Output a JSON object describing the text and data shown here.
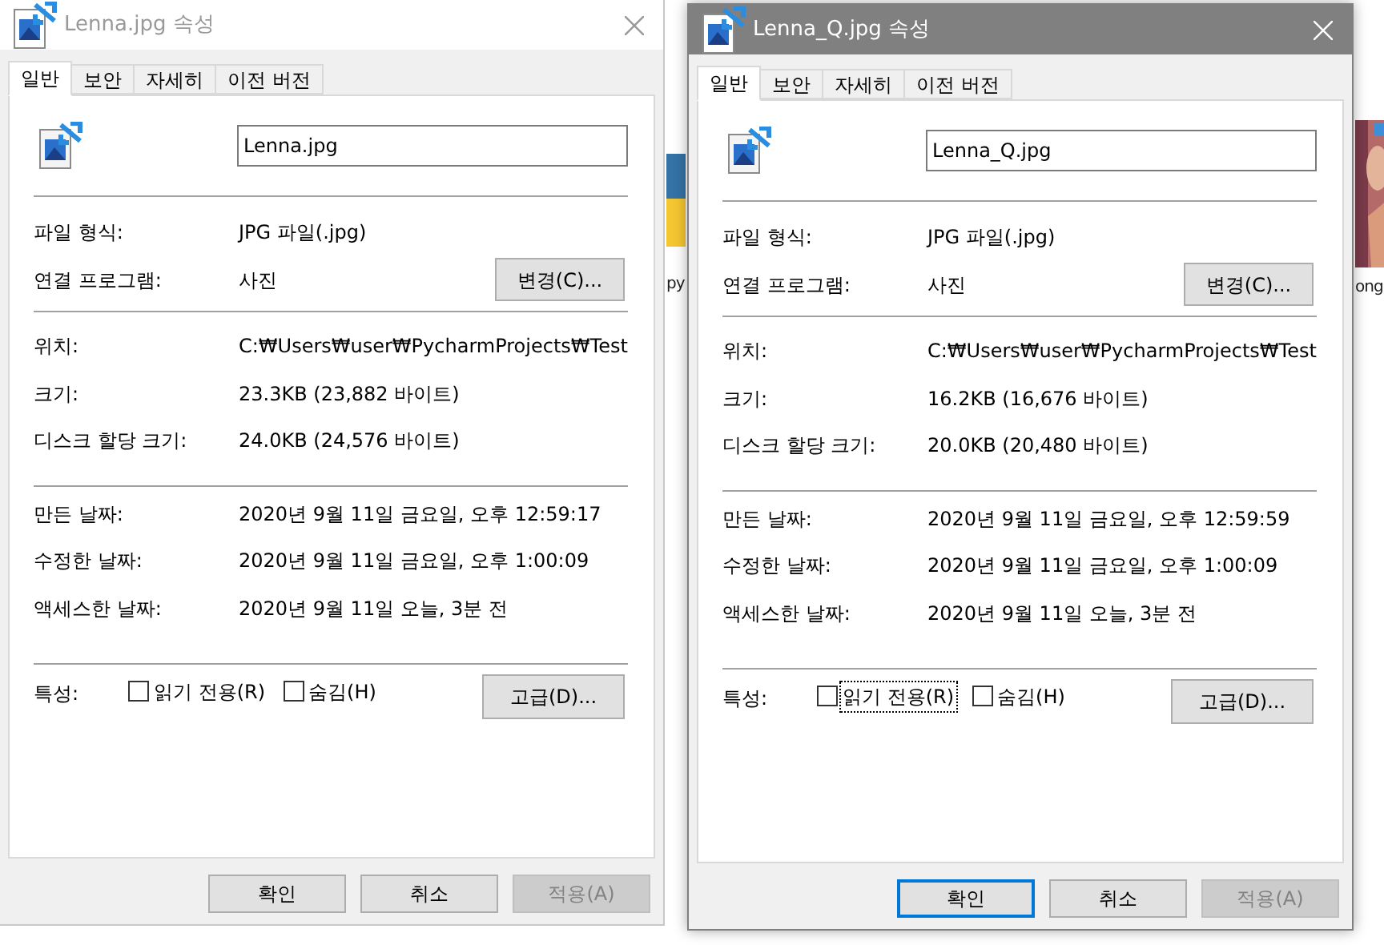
{
  "background": {
    "file_labels": [
      "py",
      "ong"
    ]
  },
  "dialogs": [
    {
      "title": "Lenna.jpg 속성",
      "active": false,
      "tabs": [
        {
          "label": "일반",
          "selected": true
        },
        {
          "label": "보안",
          "selected": false
        },
        {
          "label": "자세히",
          "selected": false
        },
        {
          "label": "이전 버전",
          "selected": false
        }
      ],
      "file_name": "Lenna.jpg",
      "type_rows": [
        {
          "label": "파일 형식:",
          "value": "JPG 파일(.jpg)"
        },
        {
          "label": "연결 프로그램:",
          "value": "사진"
        }
      ],
      "change_button": "변경(C)...",
      "location_rows": [
        {
          "label": "위치:",
          "value": "C:₩Users₩user₩PycharmProjects₩Test"
        },
        {
          "label": "크기:",
          "value": "23.3KB (23,882 바이트)"
        },
        {
          "label": "디스크 할당 크기:",
          "value": "24.0KB (24,576 바이트)"
        }
      ],
      "date_rows": [
        {
          "label": "만든 날짜:",
          "value": "2020년 9월 11일 금요일, 오후 12:59:17"
        },
        {
          "label": "수정한 날짜:",
          "value": "2020년 9월 11일 금요일, 오후 1:00:09"
        },
        {
          "label": "액세스한 날짜:",
          "value": "2020년 9월 11일 오늘, 3분 전"
        }
      ],
      "attributes_label": "특성:",
      "attributes": [
        {
          "label": "읽기 전용(R)",
          "checked": false,
          "focused": false
        },
        {
          "label": "숨김(H)",
          "checked": false,
          "focused": false
        }
      ],
      "advanced_button": "고급(D)...",
      "buttons": [
        {
          "label": "확인",
          "default": false,
          "disabled": false
        },
        {
          "label": "취소",
          "default": false,
          "disabled": false
        },
        {
          "label": "적용(A)",
          "default": false,
          "disabled": true
        }
      ]
    },
    {
      "title": "Lenna_Q.jpg 속성",
      "active": true,
      "tabs": [
        {
          "label": "일반",
          "selected": true
        },
        {
          "label": "보안",
          "selected": false
        },
        {
          "label": "자세히",
          "selected": false
        },
        {
          "label": "이전 버전",
          "selected": false
        }
      ],
      "file_name": "Lenna_Q.jpg",
      "type_rows": [
        {
          "label": "파일 형식:",
          "value": "JPG 파일(.jpg)"
        },
        {
          "label": "연결 프로그램:",
          "value": "사진"
        }
      ],
      "change_button": "변경(C)...",
      "location_rows": [
        {
          "label": "위치:",
          "value": "C:₩Users₩user₩PycharmProjects₩Test"
        },
        {
          "label": "크기:",
          "value": "16.2KB (16,676 바이트)"
        },
        {
          "label": "디스크 할당 크기:",
          "value": "20.0KB (20,480 바이트)"
        }
      ],
      "date_rows": [
        {
          "label": "만든 날짜:",
          "value": "2020년 9월 11일 금요일, 오후 12:59:59"
        },
        {
          "label": "수정한 날짜:",
          "value": "2020년 9월 11일 금요일, 오후 1:00:09"
        },
        {
          "label": "액세스한 날짜:",
          "value": "2020년 9월 11일 오늘, 3분 전"
        }
      ],
      "attributes_label": "특성:",
      "attributes": [
        {
          "label": "읽기 전용(R)",
          "checked": false,
          "focused": true
        },
        {
          "label": "숨김(H)",
          "checked": false,
          "focused": false
        }
      ],
      "advanced_button": "고급(D)...",
      "buttons": [
        {
          "label": "확인",
          "default": true,
          "disabled": false
        },
        {
          "label": "취소",
          "default": false,
          "disabled": false
        },
        {
          "label": "적용(A)",
          "default": false,
          "disabled": true
        }
      ]
    }
  ]
}
